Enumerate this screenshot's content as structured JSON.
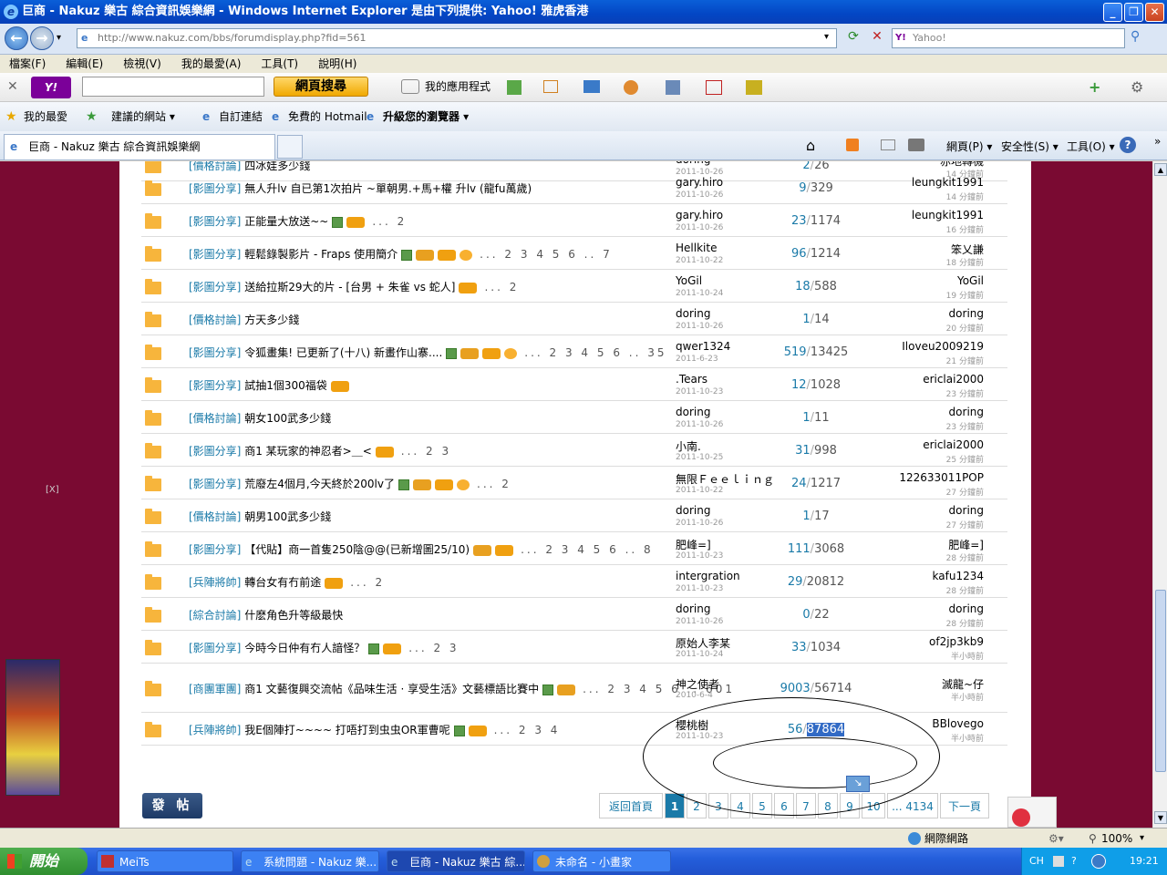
{
  "window": {
    "title": "巨商 - Nakuz 樂古 綜合資訊娛樂網 - Windows Internet Explorer 是由下列提供: Yahoo! 雅虎香港"
  },
  "address": {
    "url": "http://www.nakuz.com/bbs/forumdisplay.php?fid=561",
    "search_placeholder": "Yahoo!"
  },
  "menu": [
    "檔案(F)",
    "編輯(E)",
    "檢視(V)",
    "我的最愛(A)",
    "工具(T)",
    "說明(H)"
  ],
  "yahoo_toolbar": {
    "search_button": "網頁搜尋",
    "apps": "我的應用程式"
  },
  "favorites": {
    "label": "我的最愛",
    "items": [
      "建議的網站 ▾",
      "自訂連結",
      "免費的 Hotmail",
      "升級您的瀏覽器 ▾"
    ]
  },
  "tab": {
    "title": "巨商 - Nakuz 樂古 綜合資訊娛樂網"
  },
  "command_bar": [
    "網頁(P) ▾",
    "安全性(S) ▾",
    "工具(O) ▾"
  ],
  "threads": [
    {
      "cat": "[價格討論]",
      "title": "四冰娃多少錢",
      "badges": [],
      "pages": "",
      "author": "doring",
      "date": "2011-10-26",
      "replies": "2",
      "views": "26",
      "last": "赤地轉機",
      "last_time": "14 分鐘前"
    },
    {
      "cat": "[影圖分享]",
      "title": "無人升lv 自已第1次拍片 ~單朝男.+馬+權 升lv (龍fu萬歲)",
      "badges": [],
      "pages": "",
      "author": "gary.hiro",
      "date": "2011-10-26",
      "replies": "9",
      "views": "329",
      "last": "leungkit1991",
      "last_time": "14 分鐘前"
    },
    {
      "cat": "[影圖分享]",
      "title": "正能量大放送~~",
      "badges": [
        "img",
        "hot"
      ],
      "pages": "... 2",
      "author": "gary.hiro",
      "date": "2011-10-26",
      "replies": "23",
      "views": "1174",
      "last": "leungkit1991",
      "last_time": "16 分鐘前"
    },
    {
      "cat": "[影圖分享]",
      "title": "輕鬆錄製影片 - Fraps 使用簡介",
      "badges": [
        "img",
        "rec",
        "hot",
        "smile"
      ],
      "pages": "... 2 3 4 5 6 .. 7",
      "author": "Hellkite",
      "date": "2011-10-22",
      "replies": "96",
      "views": "1214",
      "last": "笨乂謙",
      "last_time": "18 分鐘前"
    },
    {
      "cat": "[影圖分享]",
      "title": "送給拉斯29大的片 - [台男 + 朱雀 vs 蛇人]",
      "badges": [
        "hot"
      ],
      "pages": "... 2",
      "author": "YoGil",
      "date": "2011-10-24",
      "replies": "18",
      "views": "588",
      "last": "YoGil",
      "last_time": "19 分鐘前"
    },
    {
      "cat": "[價格討論]",
      "title": "方天多少錢",
      "badges": [],
      "pages": "",
      "author": "doring",
      "date": "2011-10-26",
      "replies": "1",
      "views": "14",
      "last": "doring",
      "last_time": "20 分鐘前"
    },
    {
      "cat": "[影圖分享]",
      "title": "令狐畫集! 已更新了(十八) 新畫作山寨....",
      "badges": [
        "img",
        "rec",
        "hot",
        "smile"
      ],
      "pages": "... 2 3 4 5 6 .. 35",
      "author": "qwer1324",
      "date": "2011-6-23",
      "replies": "519",
      "views": "13425",
      "last": "Iloveu2009219",
      "last_time": "21 分鐘前"
    },
    {
      "cat": "[影圖分享]",
      "title": "試抽1個300福袋",
      "badges": [
        "hot"
      ],
      "pages": "",
      "author": ".Tears",
      "date": "2011-10-23",
      "replies": "12",
      "views": "1028",
      "last": "ericlai2000",
      "last_time": "23 分鐘前"
    },
    {
      "cat": "[價格討論]",
      "title": "朝女100武多少錢",
      "badges": [],
      "pages": "",
      "author": "doring",
      "date": "2011-10-26",
      "replies": "1",
      "views": "11",
      "last": "doring",
      "last_time": "23 分鐘前"
    },
    {
      "cat": "[影圖分享]",
      "title": "商1 某玩家的神忍者>＿<",
      "badges": [
        "hot"
      ],
      "pages": "... 2 3",
      "author": "小南.",
      "date": "2011-10-25",
      "replies": "31",
      "views": "998",
      "last": "ericlai2000",
      "last_time": "25 分鐘前"
    },
    {
      "cat": "[影圖分享]",
      "title": "荒廢左4個月,今天終於200lv了",
      "badges": [
        "img",
        "rec",
        "hot",
        "smile"
      ],
      "pages": "... 2",
      "author": "無限Ｆｅｅｌｉｎｇ",
      "date": "2011-10-22",
      "replies": "24",
      "views": "1217",
      "last": "122633011POP",
      "last_time": "27 分鐘前"
    },
    {
      "cat": "[價格討論]",
      "title": "朝男100武多少錢",
      "badges": [],
      "pages": "",
      "author": "doring",
      "date": "2011-10-26",
      "replies": "1",
      "views": "17",
      "last": "doring",
      "last_time": "27 分鐘前"
    },
    {
      "cat": "[影圖分享]",
      "title": "【代貼】商一首隻250陰@@(已新增圖25/10)",
      "badges": [
        "rec",
        "hot"
      ],
      "pages": "... 2 3 4 5 6 .. 8",
      "author": "肥峰=]",
      "date": "2011-10-23",
      "replies": "111",
      "views": "3068",
      "last": "肥峰=]",
      "last_time": "28 分鐘前"
    },
    {
      "cat": "[兵陣將帥]",
      "title": "轉台女有冇前途",
      "badges": [
        "hot"
      ],
      "pages": "... 2",
      "author": "intergration",
      "date": "2011-10-23",
      "replies": "29",
      "views": "20812",
      "last": "kafu1234",
      "last_time": "28 分鐘前"
    },
    {
      "cat": "[綜合討論]",
      "title": "什麽角色升等級最快",
      "badges": [],
      "pages": "",
      "author": "doring",
      "date": "2011-10-26",
      "replies": "0",
      "views": "22",
      "last": "doring",
      "last_time": "28 分鐘前"
    },
    {
      "cat": "[影圖分享]",
      "title": "今時今日仲有冇人諳怪？",
      "badges": [
        "img",
        "hot"
      ],
      "pages": "... 2 3",
      "author": "原始人李某",
      "date": "2011-10-24",
      "replies": "33",
      "views": "1034",
      "last": "of2jp3kb9",
      "last_time": "半小時前"
    },
    {
      "cat": "[商團軍團]",
      "title": "商1 文藝復興交流帖《品味生活 · 享受生活》文藝標語比賽中",
      "badges": [
        "img",
        "rec"
      ],
      "pages": "... 2 3 4 5 6 .. 601",
      "author": "神之使者",
      "date": "2010-6-4",
      "replies": "9003",
      "views": "56714",
      "last": "滅龍~仔",
      "last_time": "半小時前"
    },
    {
      "cat": "[兵陣將帥]",
      "title": "我E個陣打~~~~ 打唔打到虫虫OR軍曹呢",
      "badges": [
        "img",
        "hot"
      ],
      "pages": "... 2 3 4",
      "author": "櫻桃樹",
      "date": "2011-10-23",
      "replies": "56",
      "views": "87864",
      "last": "BBlovego",
      "last_time": "半小時前"
    }
  ],
  "post_button": "發 帖",
  "pager": {
    "back": "返回首頁",
    "pages": [
      "1",
      "2",
      "3",
      "4",
      "5",
      "6",
      "7",
      "8",
      "9",
      "10"
    ],
    "last": "... 4134",
    "next": "下一頁"
  },
  "ad_close": "[X]",
  "status": {
    "zone": "網際網路",
    "zoom": "100%"
  },
  "taskbar": {
    "start": "開始",
    "tasks": [
      "MeiTs",
      "系統問題 - Nakuz 樂...",
      "巨商 - Nakuz 樂古 綜...",
      "未命名 - 小畫家"
    ],
    "lang": "CH",
    "time": "19:21"
  }
}
